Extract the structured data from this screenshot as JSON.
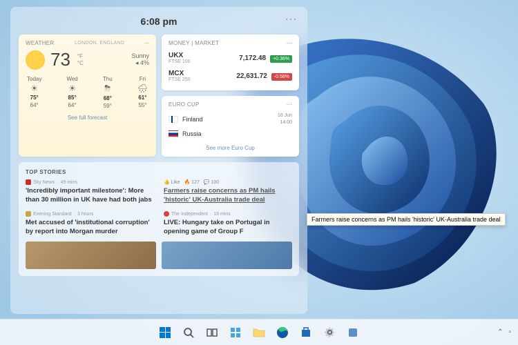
{
  "panel": {
    "time": "6:08 pm",
    "more": "···"
  },
  "weather": {
    "title": "WEATHER",
    "location": "London, England",
    "temp": "73",
    "unit1": "°F",
    "unit2": "°C",
    "condition": "Sunny",
    "precip": "◂ 4%",
    "forecast": [
      {
        "day": "Today",
        "ic": "☀",
        "hi": "75°",
        "lo": "64°"
      },
      {
        "day": "Wed",
        "ic": "☀",
        "hi": "85°",
        "lo": "64°"
      },
      {
        "day": "Thu",
        "ic": "⛈",
        "hi": "68°",
        "lo": "59°"
      },
      {
        "day": "Fri",
        "ic": "🌧",
        "hi": "61°",
        "lo": "55°"
      }
    ],
    "see": "See full forecast"
  },
  "market": {
    "title": "MONEY | MARKET",
    "rows": [
      {
        "sym": "UKX",
        "sub": "FTSE 100",
        "val": "7,172.48",
        "pct": "+0.36%",
        "dir": "up"
      },
      {
        "sym": "MCX",
        "sub": "FTSE 250",
        "val": "22,631.72",
        "pct": "-0.58%",
        "dir": "dn"
      }
    ]
  },
  "euro": {
    "title": "EURO CUP",
    "team1": "Finland",
    "team2": "Russia",
    "date": "16 Jun",
    "time": "14:00",
    "see": "See more Euro Cup"
  },
  "stories": {
    "title": "TOP STORIES",
    "items": [
      {
        "src": "Sky News",
        "age": "49 mins",
        "color": "#c52b2b",
        "headline": "'Incredibly important milestone': More than 30 million in UK have had both jabs"
      },
      {
        "src": "",
        "age": "",
        "color": "#888",
        "headline": "Farmers raise concerns as PM hails 'historic' UK-Australia trade deal",
        "engage": {
          "like": "Like",
          "r": "🔥 127",
          "c": "💬 100"
        }
      },
      {
        "src": "Evening Standard",
        "age": "3 hours",
        "color": "#c9a24a",
        "headline": "Met accused of 'institutional corruption' by report into Morgan murder"
      },
      {
        "src": "The Independent",
        "age": "18 mins",
        "color": "#d64545",
        "headline": "LIVE: Hungary take on Portugal in opening game of Group F"
      }
    ]
  },
  "tooltip": "Farmers raise concerns as PM hails 'historic' UK-Australia trade deal",
  "tray": {
    "chev": "⌃"
  }
}
